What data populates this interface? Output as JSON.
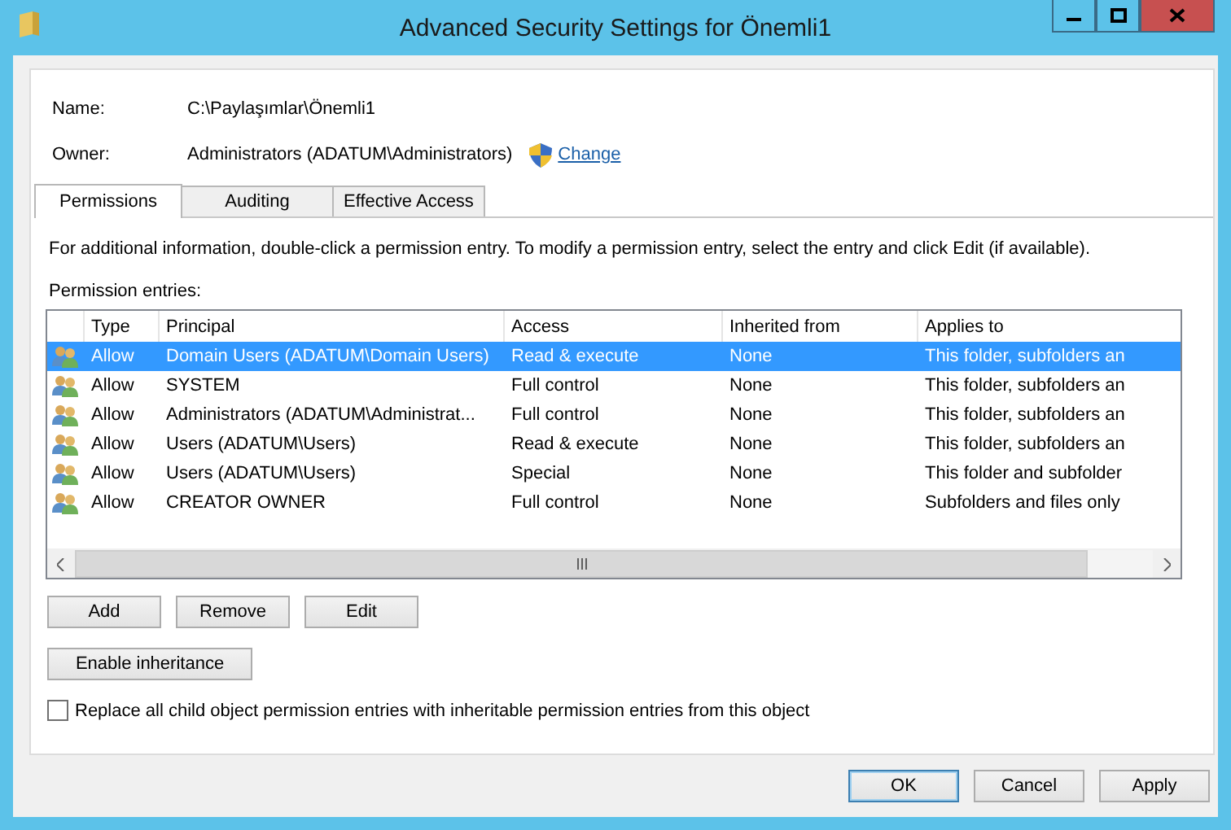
{
  "window": {
    "title": "Advanced Security Settings for Önemli1"
  },
  "name": {
    "label": "Name:",
    "value": "C:\\Paylaşımlar\\Önemli1"
  },
  "owner": {
    "label": "Owner:",
    "value": "Administrators (ADATUM\\Administrators)",
    "change_link": "Change"
  },
  "tabs": [
    {
      "label": "Permissions",
      "selected": true
    },
    {
      "label": "Auditing",
      "selected": false
    },
    {
      "label": "Effective Access",
      "selected": false
    }
  ],
  "description": "For additional information, double-click a permission entry. To modify a permission entry, select the entry and click Edit (if available).",
  "entries_label": "Permission entries:",
  "table": {
    "columns": [
      "Type",
      "Principal",
      "Access",
      "Inherited from",
      "Applies to"
    ],
    "rows": [
      {
        "cells": [
          "Allow",
          "Domain Users (ADATUM\\Domain Users)",
          "Read & execute",
          "None",
          "This folder, subfolders an"
        ],
        "selected": true
      },
      {
        "cells": [
          "Allow",
          "SYSTEM",
          "Full control",
          "None",
          "This folder, subfolders an"
        ],
        "selected": false
      },
      {
        "cells": [
          "Allow",
          "Administrators (ADATUM\\Administrat...",
          "Full control",
          "None",
          "This folder, subfolders an"
        ],
        "selected": false
      },
      {
        "cells": [
          "Allow",
          "Users (ADATUM\\Users)",
          "Read & execute",
          "None",
          "This folder, subfolders an"
        ],
        "selected": false
      },
      {
        "cells": [
          "Allow",
          "Users (ADATUM\\Users)",
          "Special",
          "None",
          "This folder and subfolder"
        ],
        "selected": false
      },
      {
        "cells": [
          "Allow",
          "CREATOR OWNER",
          "Full control",
          "None",
          "Subfolders and files only"
        ],
        "selected": false
      }
    ]
  },
  "list_buttons": [
    "Add",
    "Remove",
    "Edit"
  ],
  "inheritance_button": "Enable inheritance",
  "replace_checkbox": {
    "label": "Replace all child object permission entries with inheritable permission entries from this object",
    "checked": false
  },
  "dialog_buttons": [
    {
      "label": "OK",
      "default": true
    },
    {
      "label": "Cancel",
      "default": false
    },
    {
      "label": "Apply",
      "default": false
    }
  ]
}
